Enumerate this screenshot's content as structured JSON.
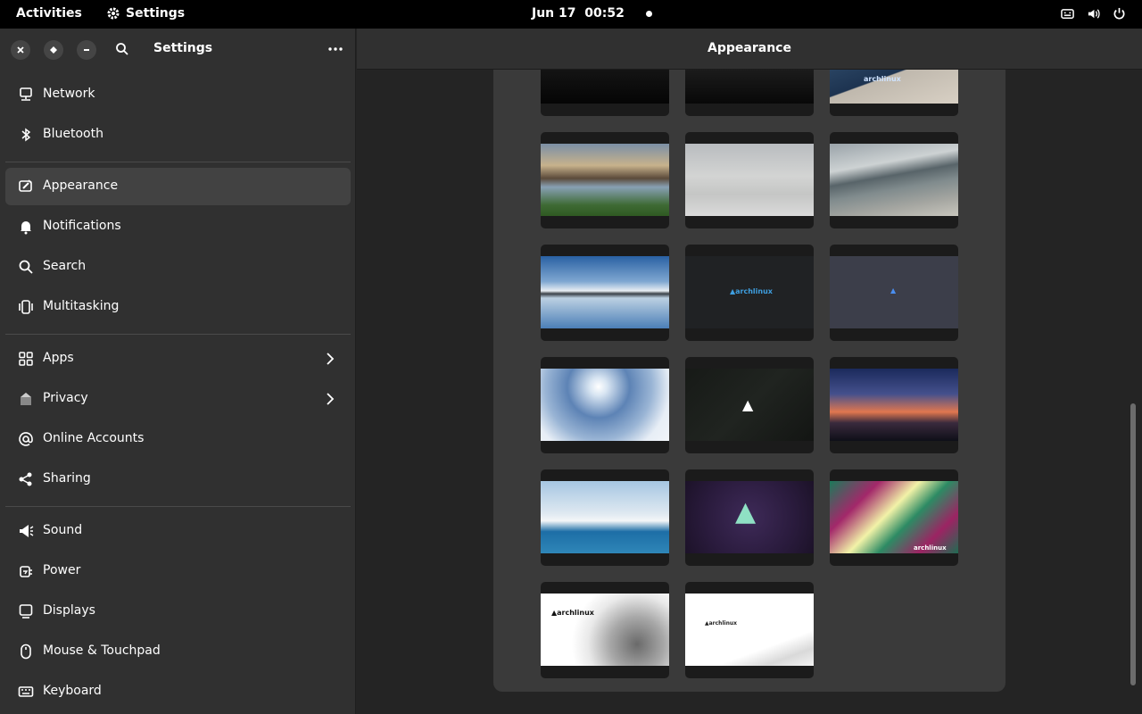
{
  "topbar": {
    "activities": "Activities",
    "app_name": "Settings",
    "date": "Jun 17",
    "time": "00:52"
  },
  "sidebar": {
    "title": "Settings",
    "items": [
      {
        "label": "Network",
        "icon": "network-icon"
      },
      {
        "label": "Bluetooth",
        "icon": "bluetooth-icon"
      },
      {
        "label": "Appearance",
        "icon": "appearance-icon",
        "active": true
      },
      {
        "label": "Notifications",
        "icon": "bell-icon"
      },
      {
        "label": "Search",
        "icon": "search-icon"
      },
      {
        "label": "Multitasking",
        "icon": "multitasking-icon"
      },
      {
        "label": "Apps",
        "icon": "apps-icon",
        "chevron": true
      },
      {
        "label": "Privacy",
        "icon": "privacy-icon",
        "chevron": true
      },
      {
        "label": "Online Accounts",
        "icon": "at-icon"
      },
      {
        "label": "Sharing",
        "icon": "share-icon"
      },
      {
        "label": "Sound",
        "icon": "speaker-icon"
      },
      {
        "label": "Power",
        "icon": "power-plug-icon"
      },
      {
        "label": "Displays",
        "icon": "display-icon"
      },
      {
        "label": "Mouse & Touchpad",
        "icon": "mouse-icon"
      },
      {
        "label": "Keyboard",
        "icon": "keyboard-icon"
      }
    ]
  },
  "main": {
    "title": "Appearance",
    "wallpapers": [
      {
        "name": "dark-texture-1"
      },
      {
        "name": "dark-texture-2"
      },
      {
        "name": "arch-laptop",
        "logo": "archlinux"
      },
      {
        "name": "fjord-sunset"
      },
      {
        "name": "misty-lake"
      },
      {
        "name": "cliff-fjord"
      },
      {
        "name": "snowy-reflection"
      },
      {
        "name": "arch-dark-logo",
        "logo": "archlinux"
      },
      {
        "name": "arch-slate-logo"
      },
      {
        "name": "snow-sun"
      },
      {
        "name": "arch-black-triangle"
      },
      {
        "name": "night-sunset"
      },
      {
        "name": "arctic-coast"
      },
      {
        "name": "arch-purple-logo"
      },
      {
        "name": "tropical-leaves",
        "logo": "archlinux"
      },
      {
        "name": "arch-sketch-1",
        "logo": "archlinux"
      },
      {
        "name": "arch-sketch-2",
        "logo": "archlinux"
      }
    ]
  },
  "colors": {
    "accent": "#3584e4",
    "sidebar_bg": "#303030",
    "active_bg": "#424242"
  }
}
